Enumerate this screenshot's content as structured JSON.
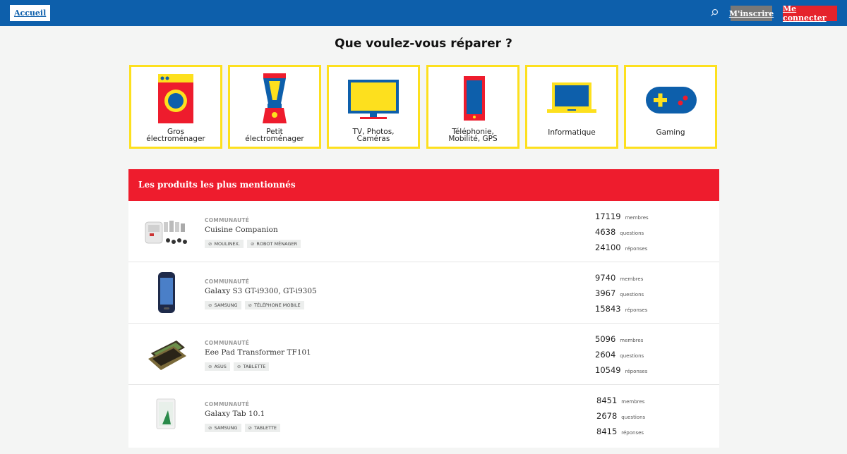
{
  "header": {
    "home_label": "Accueil",
    "signup_label": "M'inscrire",
    "login_label": "Me connecter",
    "colors": {
      "bar": "#0d5fab",
      "signup": "#787878",
      "login": "#e5232b"
    }
  },
  "title": "Que voulez-vous réparer ?",
  "categories": [
    {
      "label1": "Gros",
      "label2": "électroménager",
      "icon": "washing-machine-icon"
    },
    {
      "label1": "Petit",
      "label2": "électroménager",
      "icon": "blender-icon"
    },
    {
      "label1": "TV, Photos,",
      "label2": "Caméras",
      "icon": "tv-icon"
    },
    {
      "label1": "Téléphonie,",
      "label2": "Mobilité, GPS",
      "icon": "smartphone-icon"
    },
    {
      "label1": "Informatique",
      "label2": "",
      "icon": "laptop-icon"
    },
    {
      "label1": "Gaming",
      "label2": "",
      "icon": "gamepad-icon"
    }
  ],
  "products": {
    "title": "Les produits les plus mentionnés",
    "community_label": "COMMUNAUTÉ",
    "stat_labels": {
      "members": "membres",
      "questions": "questions",
      "answers": "réponses"
    },
    "items": [
      {
        "name": "Cuisine Companion",
        "tags": [
          "MOULINEX.",
          "ROBOT MÉNAGER"
        ],
        "members": "17119",
        "questions": "4638",
        "answers": "24100",
        "thumb": "food-processor-thumbnail"
      },
      {
        "name": "Galaxy S3 GT-i9300, GT-i9305",
        "tags": [
          "SAMSUNG",
          "TÉLÉPHONE MOBILE"
        ],
        "members": "9740",
        "questions": "3967",
        "answers": "15843",
        "thumb": "phone-thumbnail"
      },
      {
        "name": "Eee Pad Transformer TF101",
        "tags": [
          "ASUS",
          "TABLETTE"
        ],
        "members": "5096",
        "questions": "2604",
        "answers": "10549",
        "thumb": "tablet-keyboard-thumbnail"
      },
      {
        "name": "Galaxy Tab 10.1",
        "tags": [
          "SAMSUNG",
          "TABLETTE"
        ],
        "members": "8451",
        "questions": "2678",
        "answers": "8415",
        "thumb": "tablet-thumbnail"
      }
    ]
  },
  "colors": {
    "accent_red": "#ee1c2d",
    "accent_yellow": "#fde01e",
    "accent_blue": "#0d5fab"
  }
}
